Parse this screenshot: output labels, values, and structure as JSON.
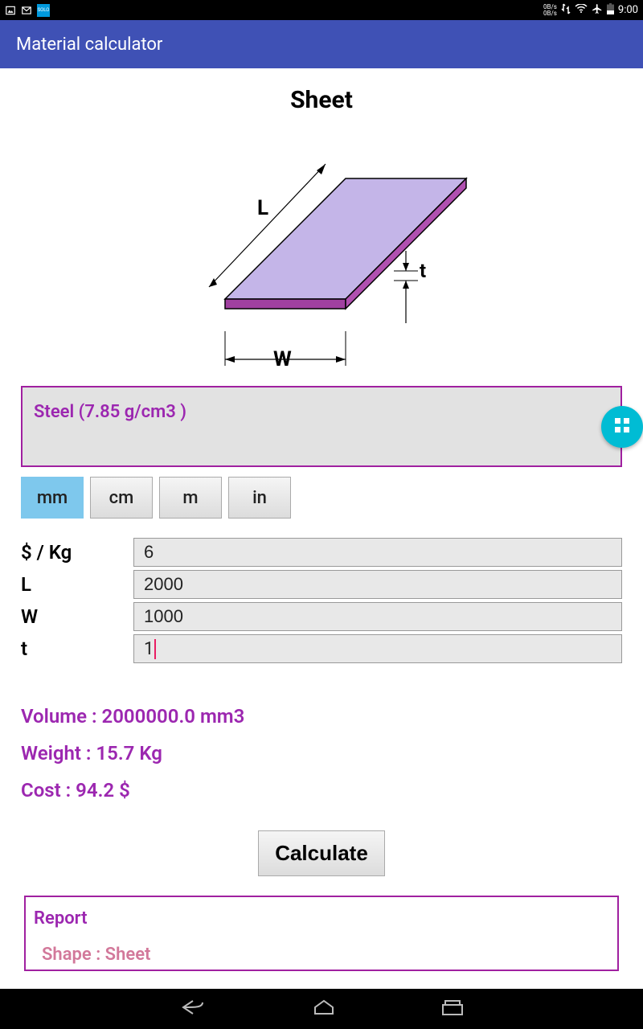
{
  "status": {
    "data_rate": "0B/s\n0B/s",
    "time": "9:00"
  },
  "app": {
    "title": "Material calculator"
  },
  "shape": {
    "title": "Sheet",
    "labels": {
      "l": "L",
      "w": "W",
      "t": "t"
    }
  },
  "material": {
    "text": "Steel  (7.85 g/cm3 )"
  },
  "units": {
    "options": [
      "mm",
      "cm",
      "m",
      "in"
    ],
    "selected": "mm"
  },
  "inputs": {
    "price": {
      "label": "$ / Kg",
      "value": "6"
    },
    "length": {
      "label": "L",
      "value": "2000"
    },
    "width": {
      "label": "W",
      "value": "1000"
    },
    "thickness": {
      "label": "t",
      "value": "1"
    }
  },
  "results": {
    "volume": "Volume : 2000000.0  mm3",
    "weight": "Weight   : 15.7  Kg",
    "cost": "Cost   : 94.2  $"
  },
  "actions": {
    "calculate": "Calculate"
  },
  "report": {
    "title": "Report",
    "line1": "Shape   : Sheet"
  }
}
